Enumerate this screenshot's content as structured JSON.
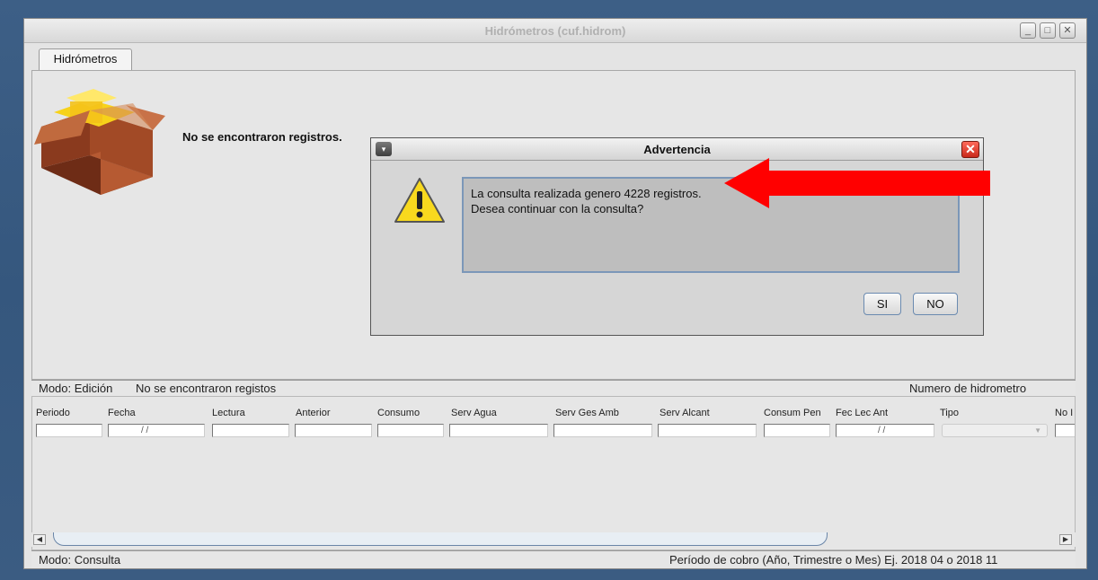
{
  "window": {
    "title": "Hidrómetros (cuf.hidrom)",
    "minimize_glyph": "_",
    "maximize_glyph": "□",
    "close_glyph": "✕"
  },
  "tab": {
    "label": "Hidrómetros"
  },
  "content": {
    "message": "No se encontraron registros."
  },
  "dialog": {
    "title": "Advertencia",
    "menu_glyph": "▾",
    "close_glyph": "✕",
    "message_line1": "La consulta realizada genero 4228 registros.",
    "message_line2": "Desea continuar con la consulta?",
    "yes_label": "SI",
    "no_label": "NO"
  },
  "status_edit": {
    "mode": "Modo: Edición",
    "message": "No se encontraron registos",
    "right_label": "Numero de hidrometro"
  },
  "grid": {
    "columns": [
      {
        "label": "Periodo",
        "value": ""
      },
      {
        "label": "Fecha",
        "value": "/ /"
      },
      {
        "label": "Lectura",
        "value": ""
      },
      {
        "label": "Anterior",
        "value": ""
      },
      {
        "label": "Consumo",
        "value": ""
      },
      {
        "label": "Serv Agua",
        "value": ""
      },
      {
        "label": "Serv Ges Amb",
        "value": ""
      },
      {
        "label": "Serv Alcant",
        "value": ""
      },
      {
        "label": "Consum Pen",
        "value": ""
      },
      {
        "label": "Fec Lec Ant",
        "value": "/ /"
      },
      {
        "label": "Tipo",
        "value": ""
      },
      {
        "label": "No I",
        "value": ""
      }
    ],
    "scroll_left": "◀",
    "scroll_right": "▶",
    "dropdown_glyph": "▼"
  },
  "status_consulta": {
    "mode": "Modo: Consulta",
    "period": "Período de cobro (Año, Trimestre o Mes) Ej. 2018 04 o 2018 11"
  },
  "colors": {
    "desktop": "#3d5f86",
    "arrow": "#ff0000",
    "dialog_close": "#d8392a",
    "message_border": "#7b97b8"
  },
  "icons": [
    "package-box-icon",
    "warning-icon",
    "red-arrow-annotation"
  ]
}
